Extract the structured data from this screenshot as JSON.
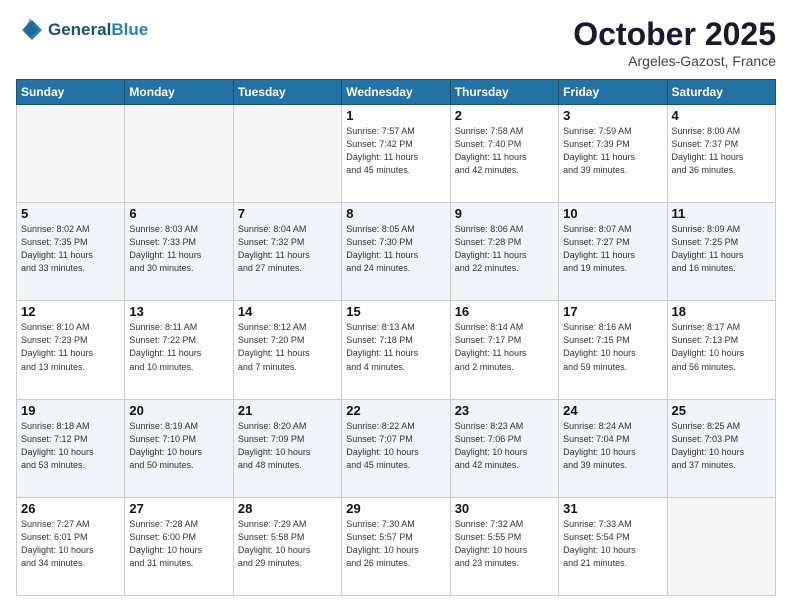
{
  "header": {
    "logo_line1": "General",
    "logo_line2": "Blue",
    "month": "October 2025",
    "location": "Argeles-Gazost, France"
  },
  "weekdays": [
    "Sunday",
    "Monday",
    "Tuesday",
    "Wednesday",
    "Thursday",
    "Friday",
    "Saturday"
  ],
  "weeks": [
    [
      {
        "day": "",
        "info": ""
      },
      {
        "day": "",
        "info": ""
      },
      {
        "day": "",
        "info": ""
      },
      {
        "day": "1",
        "info": "Sunrise: 7:57 AM\nSunset: 7:42 PM\nDaylight: 11 hours\nand 45 minutes."
      },
      {
        "day": "2",
        "info": "Sunrise: 7:58 AM\nSunset: 7:40 PM\nDaylight: 11 hours\nand 42 minutes."
      },
      {
        "day": "3",
        "info": "Sunrise: 7:59 AM\nSunset: 7:39 PM\nDaylight: 11 hours\nand 39 minutes."
      },
      {
        "day": "4",
        "info": "Sunrise: 8:00 AM\nSunset: 7:37 PM\nDaylight: 11 hours\nand 36 minutes."
      }
    ],
    [
      {
        "day": "5",
        "info": "Sunrise: 8:02 AM\nSunset: 7:35 PM\nDaylight: 11 hours\nand 33 minutes."
      },
      {
        "day": "6",
        "info": "Sunrise: 8:03 AM\nSunset: 7:33 PM\nDaylight: 11 hours\nand 30 minutes."
      },
      {
        "day": "7",
        "info": "Sunrise: 8:04 AM\nSunset: 7:32 PM\nDaylight: 11 hours\nand 27 minutes."
      },
      {
        "day": "8",
        "info": "Sunrise: 8:05 AM\nSunset: 7:30 PM\nDaylight: 11 hours\nand 24 minutes."
      },
      {
        "day": "9",
        "info": "Sunrise: 8:06 AM\nSunset: 7:28 PM\nDaylight: 11 hours\nand 22 minutes."
      },
      {
        "day": "10",
        "info": "Sunrise: 8:07 AM\nSunset: 7:27 PM\nDaylight: 11 hours\nand 19 minutes."
      },
      {
        "day": "11",
        "info": "Sunrise: 8:09 AM\nSunset: 7:25 PM\nDaylight: 11 hours\nand 16 minutes."
      }
    ],
    [
      {
        "day": "12",
        "info": "Sunrise: 8:10 AM\nSunset: 7:23 PM\nDaylight: 11 hours\nand 13 minutes."
      },
      {
        "day": "13",
        "info": "Sunrise: 8:11 AM\nSunset: 7:22 PM\nDaylight: 11 hours\nand 10 minutes."
      },
      {
        "day": "14",
        "info": "Sunrise: 8:12 AM\nSunset: 7:20 PM\nDaylight: 11 hours\nand 7 minutes."
      },
      {
        "day": "15",
        "info": "Sunrise: 8:13 AM\nSunset: 7:18 PM\nDaylight: 11 hours\nand 4 minutes."
      },
      {
        "day": "16",
        "info": "Sunrise: 8:14 AM\nSunset: 7:17 PM\nDaylight: 11 hours\nand 2 minutes."
      },
      {
        "day": "17",
        "info": "Sunrise: 8:16 AM\nSunset: 7:15 PM\nDaylight: 10 hours\nand 59 minutes."
      },
      {
        "day": "18",
        "info": "Sunrise: 8:17 AM\nSunset: 7:13 PM\nDaylight: 10 hours\nand 56 minutes."
      }
    ],
    [
      {
        "day": "19",
        "info": "Sunrise: 8:18 AM\nSunset: 7:12 PM\nDaylight: 10 hours\nand 53 minutes."
      },
      {
        "day": "20",
        "info": "Sunrise: 8:19 AM\nSunset: 7:10 PM\nDaylight: 10 hours\nand 50 minutes."
      },
      {
        "day": "21",
        "info": "Sunrise: 8:20 AM\nSunset: 7:09 PM\nDaylight: 10 hours\nand 48 minutes."
      },
      {
        "day": "22",
        "info": "Sunrise: 8:22 AM\nSunset: 7:07 PM\nDaylight: 10 hours\nand 45 minutes."
      },
      {
        "day": "23",
        "info": "Sunrise: 8:23 AM\nSunset: 7:06 PM\nDaylight: 10 hours\nand 42 minutes."
      },
      {
        "day": "24",
        "info": "Sunrise: 8:24 AM\nSunset: 7:04 PM\nDaylight: 10 hours\nand 39 minutes."
      },
      {
        "day": "25",
        "info": "Sunrise: 8:25 AM\nSunset: 7:03 PM\nDaylight: 10 hours\nand 37 minutes."
      }
    ],
    [
      {
        "day": "26",
        "info": "Sunrise: 7:27 AM\nSunset: 6:01 PM\nDaylight: 10 hours\nand 34 minutes."
      },
      {
        "day": "27",
        "info": "Sunrise: 7:28 AM\nSunset: 6:00 PM\nDaylight: 10 hours\nand 31 minutes."
      },
      {
        "day": "28",
        "info": "Sunrise: 7:29 AM\nSunset: 5:58 PM\nDaylight: 10 hours\nand 29 minutes."
      },
      {
        "day": "29",
        "info": "Sunrise: 7:30 AM\nSunset: 5:57 PM\nDaylight: 10 hours\nand 26 minutes."
      },
      {
        "day": "30",
        "info": "Sunrise: 7:32 AM\nSunset: 5:55 PM\nDaylight: 10 hours\nand 23 minutes."
      },
      {
        "day": "31",
        "info": "Sunrise: 7:33 AM\nSunset: 5:54 PM\nDaylight: 10 hours\nand 21 minutes."
      },
      {
        "day": "",
        "info": ""
      }
    ]
  ]
}
